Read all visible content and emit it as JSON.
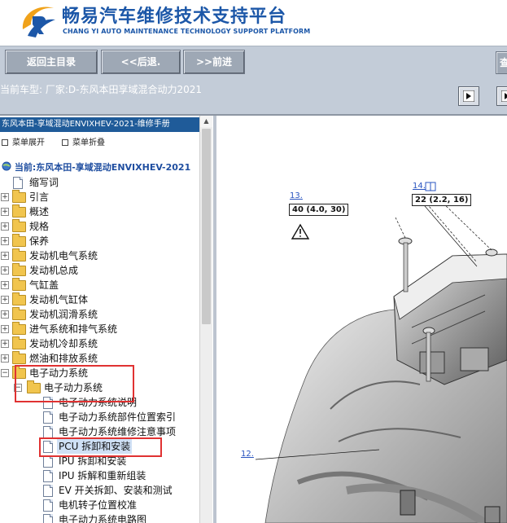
{
  "header": {
    "title": "畅易汽车维修技术支持平台",
    "subtitle": "CHANG YI AUTO MAINTENANCE TECHNOLOGY SUPPORT PLATFORM",
    "brand_color": "#1c57a8",
    "logo_icon": "swirl-logo-icon"
  },
  "toolbar": {
    "home_label": "返回主目录",
    "back_label": "<<后退.",
    "forward_label": ">>前进",
    "cut_label": "查"
  },
  "infobar": {
    "model_text": "当前车型:   厂家:D-东风本田享域混合动力2021"
  },
  "sidebar": {
    "title": "东风本田-享域混动ENVIXHEV-2021-维修手册",
    "expand_label": "菜单展开",
    "collapse_label": "菜单折叠",
    "current_label": "当前:东风本田-享域混动ENVIXHEV-2021",
    "items": [
      {
        "label": "缩写词"
      },
      {
        "label": "引言"
      },
      {
        "label": "概述"
      },
      {
        "label": "规格"
      },
      {
        "label": "保养"
      },
      {
        "label": "发动机电气系统"
      },
      {
        "label": "发动机总成"
      },
      {
        "label": "气缸盖"
      },
      {
        "label": "发动机气缸体"
      },
      {
        "label": "发动机润滑系统"
      },
      {
        "label": "进气系统和排气系统"
      },
      {
        "label": "发动机冷却系统"
      },
      {
        "label": "燃油和排放系统"
      },
      {
        "label": "电子动力系统"
      },
      {
        "label": "电子动力系统"
      },
      {
        "label": "电子动力系统说明"
      },
      {
        "label": "电子动力系统部件位置索引"
      },
      {
        "label": "电子动力系统维修注意事项"
      },
      {
        "label": "PCU 拆卸和安装"
      },
      {
        "label": "IPU 拆卸和安装"
      },
      {
        "label": "IPU 拆解和重新组装"
      },
      {
        "label": "EV 开关拆卸、安装和测试"
      },
      {
        "label": "电机转子位置校准"
      },
      {
        "label": "电子动力系统电路图"
      }
    ]
  },
  "diagram": {
    "callouts": {
      "c13": "13.",
      "c14": "14.",
      "c14_icon": "book-icon",
      "c12": "12."
    },
    "torque_13": "40 (4.0, 30)",
    "torque_14": "22 (2.2, 16)",
    "warning_icon": "warning-triangle-icon"
  },
  "colors": {
    "toolbar_bg": "#c3ccd8",
    "sidebar_title_bg": "#1f5b99",
    "highlight_box": "#e03232",
    "link_blue": "#2a55c0"
  }
}
